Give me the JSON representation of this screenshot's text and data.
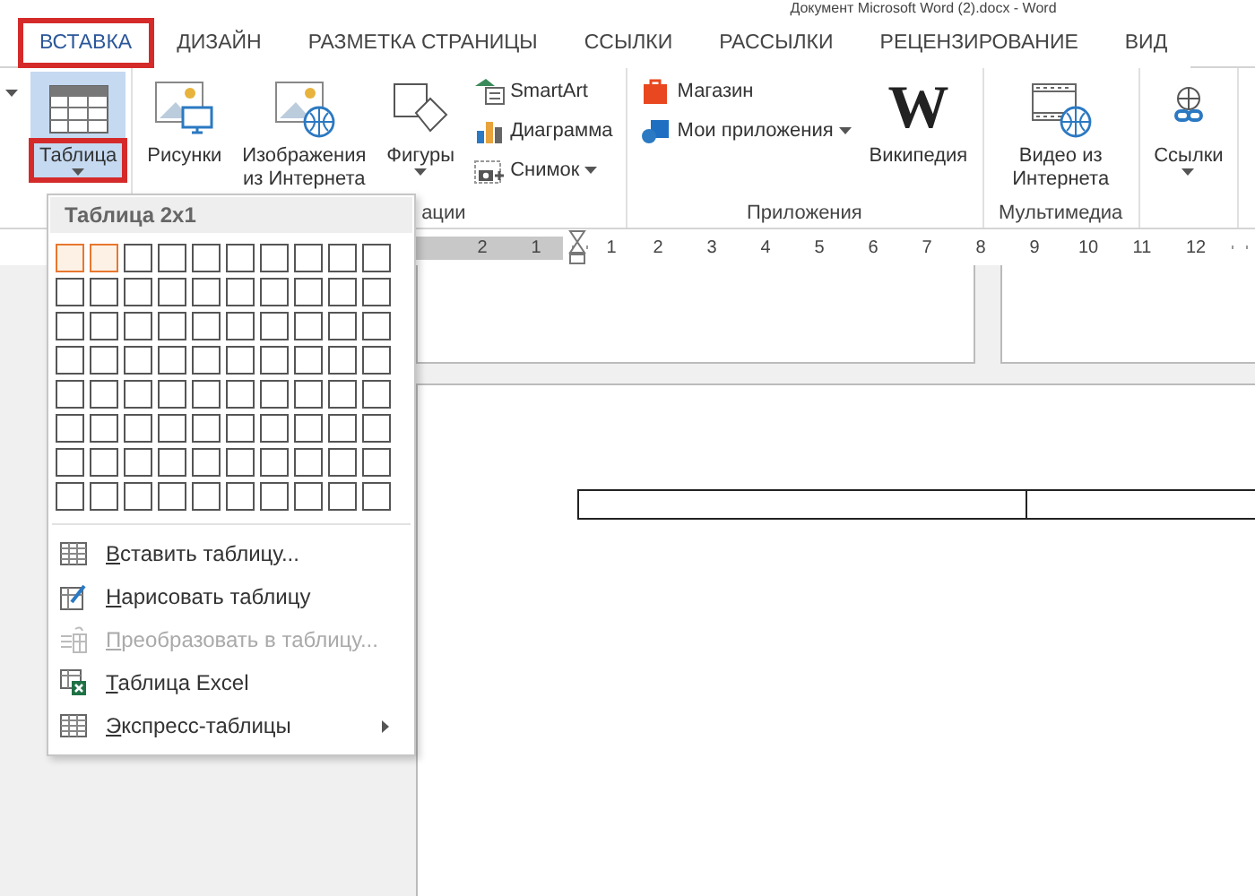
{
  "window": {
    "title": "Документ Microsoft Word (2).docx - Word"
  },
  "tabs": [
    {
      "label": "ВСТАВКА",
      "selected": true,
      "annotated": true
    },
    {
      "label": "ДИЗАЙН",
      "selected": false,
      "annotated": false
    },
    {
      "label": "РАЗМЕТКА СТРАНИЦЫ",
      "selected": false,
      "annotated": false
    },
    {
      "label": "ССЫЛКИ",
      "selected": false,
      "annotated": false
    },
    {
      "label": "РАССЫЛКИ",
      "selected": false,
      "annotated": false
    },
    {
      "label": "РЕЦЕНЗИРОВАНИЕ",
      "selected": false,
      "annotated": false
    },
    {
      "label": "ВИД",
      "selected": false,
      "annotated": false
    }
  ],
  "ribbon": {
    "groups": [
      {
        "items": [
          {
            "kind": "large",
            "label": "Таблица",
            "dropdown": true,
            "pressed": true,
            "annotated": true
          }
        ]
      },
      {
        "label": "ации",
        "items": [
          {
            "kind": "large",
            "label": "Рисунки",
            "dropdown": false,
            "pressed": false,
            "annotated": false
          },
          {
            "kind": "large",
            "label": "Изображения из Интернета",
            "dropdown": false,
            "pressed": false,
            "annotated": false
          },
          {
            "kind": "large",
            "label": "Фигуры",
            "dropdown": true,
            "pressed": false,
            "annotated": false
          },
          {
            "kind": "stack",
            "items": [
              {
                "label": "SmartArt",
                "dropdown": false
              },
              {
                "label": "Диаграмма",
                "dropdown": false
              },
              {
                "label": "Снимок",
                "dropdown": true
              }
            ]
          }
        ]
      },
      {
        "label": "Приложения",
        "items": [
          {
            "kind": "stack",
            "items": [
              {
                "label": "Магазин",
                "dropdown": false
              },
              {
                "label": "Мои приложения",
                "dropdown": true
              }
            ]
          },
          {
            "kind": "large",
            "label": "Википедия",
            "icon_glyph": "W",
            "dropdown": false,
            "pressed": false,
            "annotated": false
          }
        ]
      },
      {
        "label": "Мультимедиа",
        "items": [
          {
            "kind": "large",
            "label": "Видео из Интернета",
            "dropdown": false,
            "pressed": false,
            "annotated": false
          }
        ]
      },
      {
        "items": [
          {
            "kind": "large",
            "label": "Ссылки",
            "dropdown": true,
            "pressed": false,
            "annotated": false
          }
        ]
      }
    ]
  },
  "ruler": {
    "labels": [
      "2",
      "1",
      "1",
      "2",
      "3",
      "4",
      "5",
      "6",
      "7",
      "8",
      "9",
      "10",
      "11",
      "12"
    ]
  },
  "table_menu": {
    "title": "Таблица 2x1",
    "grid": [
      {
        "cells": [
          {
            "selected": true
          },
          {
            "selected": true
          },
          {
            "selected": false
          },
          {
            "selected": false
          },
          {
            "selected": false
          },
          {
            "selected": false
          },
          {
            "selected": false
          },
          {
            "selected": false
          },
          {
            "selected": false
          },
          {
            "selected": false
          }
        ]
      },
      {
        "cells": [
          {
            "selected": false
          },
          {
            "selected": false
          },
          {
            "selected": false
          },
          {
            "selected": false
          },
          {
            "selected": false
          },
          {
            "selected": false
          },
          {
            "selected": false
          },
          {
            "selected": false
          },
          {
            "selected": false
          },
          {
            "selected": false
          }
        ]
      },
      {
        "cells": [
          {
            "selected": false
          },
          {
            "selected": false
          },
          {
            "selected": false
          },
          {
            "selected": false
          },
          {
            "selected": false
          },
          {
            "selected": false
          },
          {
            "selected": false
          },
          {
            "selected": false
          },
          {
            "selected": false
          },
          {
            "selected": false
          }
        ]
      },
      {
        "cells": [
          {
            "selected": false
          },
          {
            "selected": false
          },
          {
            "selected": false
          },
          {
            "selected": false
          },
          {
            "selected": false
          },
          {
            "selected": false
          },
          {
            "selected": false
          },
          {
            "selected": false
          },
          {
            "selected": false
          },
          {
            "selected": false
          }
        ]
      },
      {
        "cells": [
          {
            "selected": false
          },
          {
            "selected": false
          },
          {
            "selected": false
          },
          {
            "selected": false
          },
          {
            "selected": false
          },
          {
            "selected": false
          },
          {
            "selected": false
          },
          {
            "selected": false
          },
          {
            "selected": false
          },
          {
            "selected": false
          }
        ]
      },
      {
        "cells": [
          {
            "selected": false
          },
          {
            "selected": false
          },
          {
            "selected": false
          },
          {
            "selected": false
          },
          {
            "selected": false
          },
          {
            "selected": false
          },
          {
            "selected": false
          },
          {
            "selected": false
          },
          {
            "selected": false
          },
          {
            "selected": false
          }
        ]
      },
      {
        "cells": [
          {
            "selected": false
          },
          {
            "selected": false
          },
          {
            "selected": false
          },
          {
            "selected": false
          },
          {
            "selected": false
          },
          {
            "selected": false
          },
          {
            "selected": false
          },
          {
            "selected": false
          },
          {
            "selected": false
          },
          {
            "selected": false
          }
        ]
      },
      {
        "cells": [
          {
            "selected": false
          },
          {
            "selected": false
          },
          {
            "selected": false
          },
          {
            "selected": false
          },
          {
            "selected": false
          },
          {
            "selected": false
          },
          {
            "selected": false
          },
          {
            "selected": false
          },
          {
            "selected": false
          },
          {
            "selected": false
          }
        ]
      }
    ],
    "items": [
      {
        "label": "Вставить таблицу...",
        "disabled": false,
        "submenu": false
      },
      {
        "label": "Нарисовать таблицу",
        "disabled": false,
        "submenu": false
      },
      {
        "label": "Преобразовать в таблицу...",
        "disabled": true,
        "submenu": false
      },
      {
        "label": "Таблица Excel",
        "disabled": false,
        "submenu": false
      },
      {
        "label": "Экспресс-таблицы",
        "disabled": false,
        "submenu": true
      }
    ]
  }
}
